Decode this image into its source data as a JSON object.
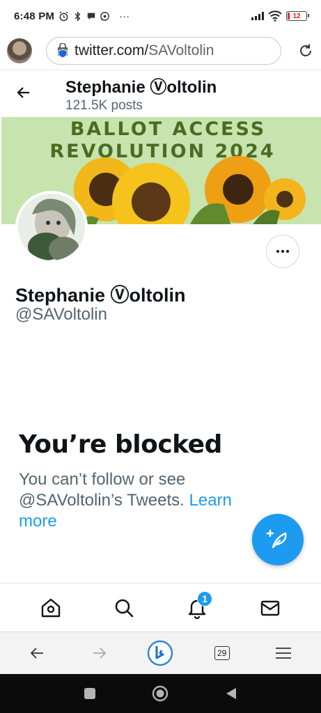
{
  "status_bar": {
    "time": "6:48 PM",
    "battery_level": "12",
    "more": "···"
  },
  "browser": {
    "url_host": "twitter.com/",
    "url_path": "SAVoltolin"
  },
  "profile_header": {
    "name": "Stephanie Ⓥoltolin",
    "posts": "121.5K posts"
  },
  "banner": {
    "line1": "BALLOT ACCESS",
    "line2": "REVOLUTION 2024"
  },
  "profile": {
    "name": "Stephanie Ⓥoltolin",
    "handle": "@SAVoltolin"
  },
  "blocked": {
    "title": "You’re blocked",
    "message": "You can’t follow or see @SAVoltolin’s Tweets.",
    "learn_more": "Learn more"
  },
  "twitter_nav": {
    "notifications_badge": "1",
    "icons": [
      "home-icon",
      "search-icon",
      "bell-icon",
      "mail-icon"
    ]
  },
  "browser_nav": {
    "tab_count": "29",
    "icons": [
      "back-arrow-icon",
      "forward-arrow-icon",
      "bing-icon",
      "tabs-icon",
      "menu-icon"
    ]
  },
  "colors": {
    "twitter_blue": "#1d9bf0",
    "text_primary": "#0f1419",
    "text_secondary": "#536471",
    "banner_green": "#c7e3ae"
  }
}
